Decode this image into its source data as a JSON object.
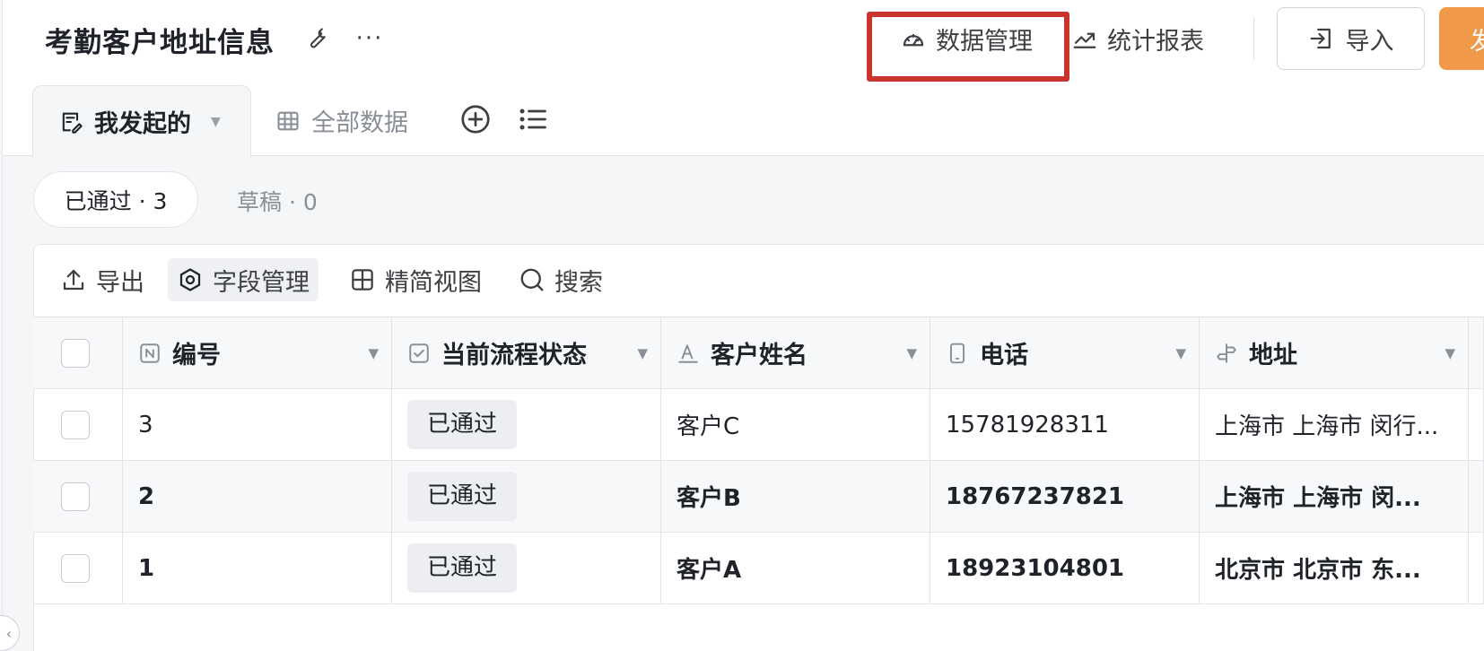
{
  "header": {
    "title": "考勤客户地址信息",
    "data_manage": "数据管理",
    "stats_report": "统计报表",
    "import": "导入",
    "primary_action": "发"
  },
  "tabs": {
    "active": "我发起的",
    "all": "全部数据"
  },
  "filters": {
    "approved": "已通过 · 3",
    "draft": "草稿 · 0"
  },
  "toolbar": {
    "export": "导出",
    "fields": "字段管理",
    "simple_view": "精简视图",
    "search": "搜索"
  },
  "table": {
    "columns": [
      "编号",
      "当前流程状态",
      "客户姓名",
      "电话",
      "地址"
    ],
    "rows": [
      {
        "id": "3",
        "status": "已通过",
        "name": "客户C",
        "phone": "15781928311",
        "address": "上海市 上海市 闵行..."
      },
      {
        "id": "2",
        "status": "已通过",
        "name": "客户B",
        "phone": "18767237821",
        "address": "上海市 上海市 闵..."
      },
      {
        "id": "1",
        "status": "已通过",
        "name": "客户A",
        "phone": "18923104801",
        "address": "北京市 北京市 东..."
      }
    ]
  },
  "colors": {
    "highlight": "#c8332c",
    "primary": "#f09a49",
    "border": "#e2e4e8"
  }
}
